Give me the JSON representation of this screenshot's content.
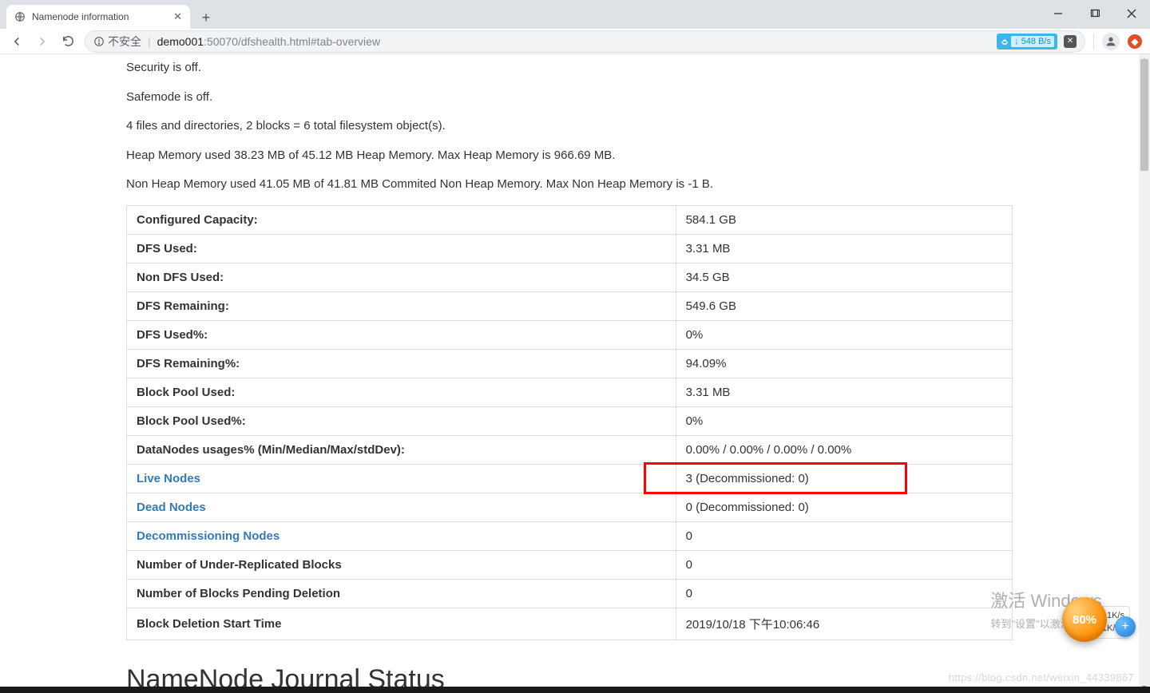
{
  "browser": {
    "tab_title": "Namenode information",
    "secure_label": "不安全",
    "url_host_bold": "demo001",
    "url_rest": ":50070/dfshealth.html#tab-overview",
    "ext_speed": "548 B/s"
  },
  "status_lines": {
    "security": "Security is off.",
    "safemode": "Safemode is off.",
    "fs_objects": "4 files and directories, 2 blocks = 6 total filesystem object(s).",
    "heap": "Heap Memory used 38.23 MB of 45.12 MB Heap Memory. Max Heap Memory is 966.69 MB.",
    "nonheap": "Non Heap Memory used 41.05 MB of 41.81 MB Commited Non Heap Memory. Max Non Heap Memory is -1 B."
  },
  "summary": [
    {
      "label": "Configured Capacity:",
      "value": "584.1 GB",
      "link": false
    },
    {
      "label": "DFS Used:",
      "value": "3.31 MB",
      "link": false
    },
    {
      "label": "Non DFS Used:",
      "value": "34.5 GB",
      "link": false
    },
    {
      "label": "DFS Remaining:",
      "value": "549.6 GB",
      "link": false
    },
    {
      "label": "DFS Used%:",
      "value": "0%",
      "link": false
    },
    {
      "label": "DFS Remaining%:",
      "value": "94.09%",
      "link": false
    },
    {
      "label": "Block Pool Used:",
      "value": "3.31 MB",
      "link": false
    },
    {
      "label": "Block Pool Used%:",
      "value": "0%",
      "link": false
    },
    {
      "label": "DataNodes usages% (Min/Median/Max/stdDev):",
      "value": "0.00% / 0.00% / 0.00% / 0.00%",
      "link": false
    },
    {
      "label": "Live Nodes",
      "value": "3 (Decommissioned: 0)",
      "link": true,
      "highlight": true
    },
    {
      "label": "Dead Nodes",
      "value": "0 (Decommissioned: 0)",
      "link": true
    },
    {
      "label": "Decommissioning Nodes",
      "value": "0",
      "link": true
    },
    {
      "label": "Number of Under-Replicated Blocks",
      "value": "0",
      "link": false
    },
    {
      "label": "Number of Blocks Pending Deletion",
      "value": "0",
      "link": false
    },
    {
      "label": "Block Deletion Start Time",
      "value": "2019/10/18 下午10:06:46",
      "link": false
    }
  ],
  "journal_heading": "NameNode Journal Status",
  "watermark": {
    "line1": "激活 Windows",
    "line2": "转到\"设置\"以激活 Windows。"
  },
  "net_overlay": {
    "percent": "80%",
    "up": "15.1K/s",
    "down": "3.1K/s"
  },
  "csdn_watermark": "https://blog.csdn.net/weixin_44339867"
}
